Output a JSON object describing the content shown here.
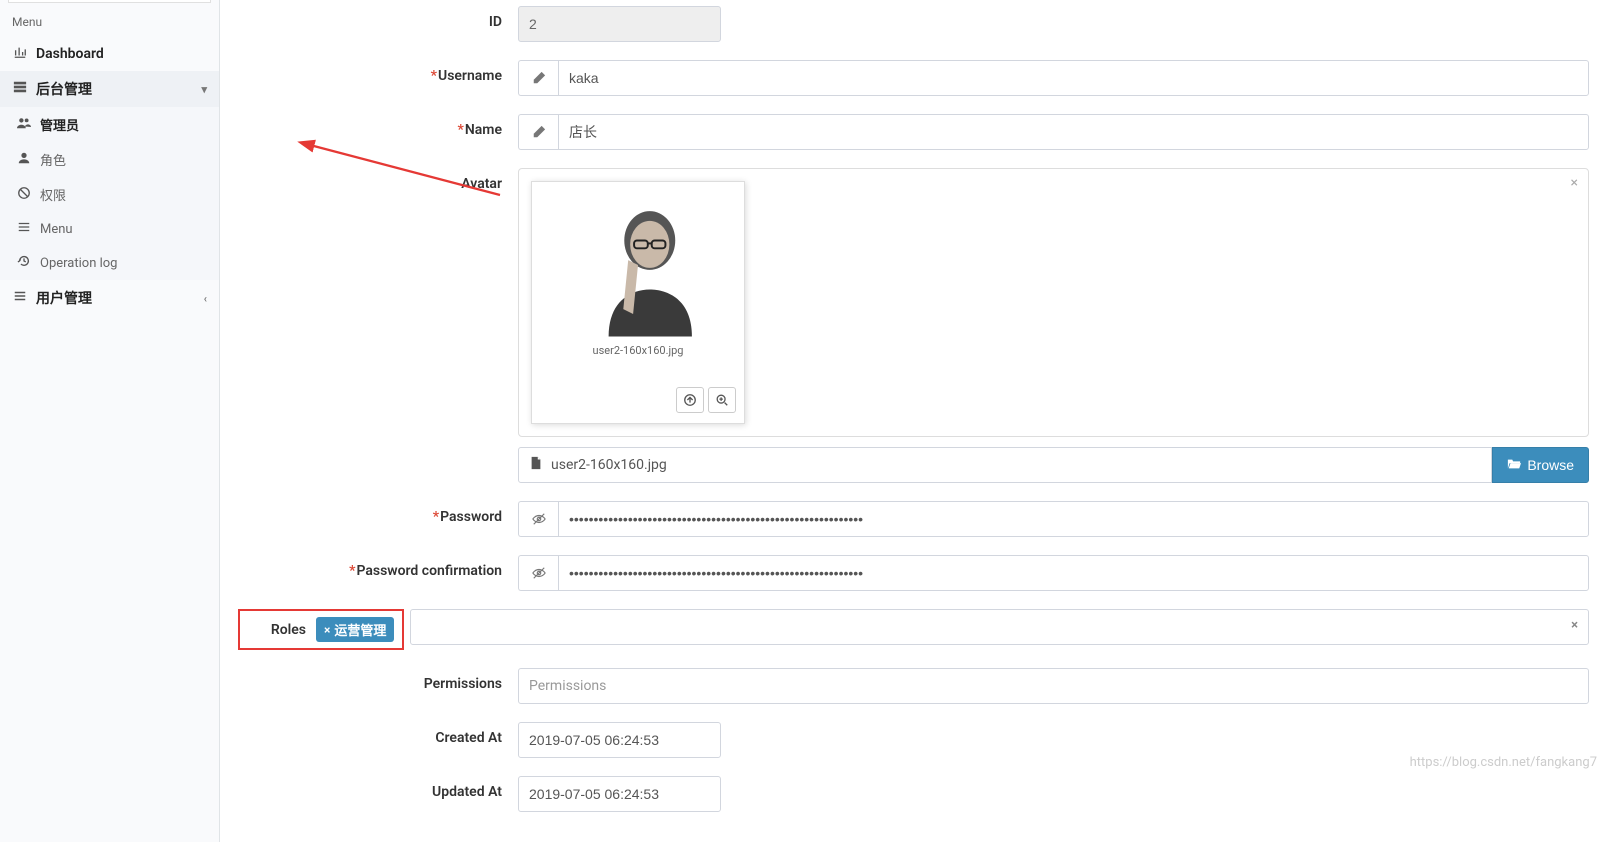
{
  "sidebar": {
    "menu_header": "Menu",
    "dashboard": "Dashboard",
    "admin_group": "后台管理",
    "items": {
      "admins": "管理员",
      "roles": "角色",
      "permissions": "权限",
      "menu": "Menu",
      "oplog": "Operation log"
    },
    "user_group": "用户管理"
  },
  "form": {
    "id_label": "ID",
    "id_value": "2",
    "username_label": "Username",
    "username_value": "kaka",
    "name_label": "Name",
    "name_value": "店长",
    "avatar_label": "Avatar",
    "avatar_filename": "user2-160x160.jpg",
    "avatar_path": "user2-160x160.jpg",
    "browse_label": "Browse",
    "password_label": "Password",
    "password_value": "••••••••••••••••••••••••••••••••••••••••••••••••••••••••••••",
    "password_confirm_label": "Password confirmation",
    "password_confirm_value": "••••••••••••••••••••••••••••••••••••••••••••••••••••••••••••",
    "roles_label": "Roles",
    "roles_tag": "运营管理",
    "permissions_label": "Permissions",
    "permissions_placeholder": "Permissions",
    "created_label": "Created At",
    "created_value": "2019-07-05 06:24:53",
    "updated_label": "Updated At",
    "updated_value": "2019-07-05 06:24:53"
  },
  "watermark": "https://blog.csdn.net/fangkang7"
}
